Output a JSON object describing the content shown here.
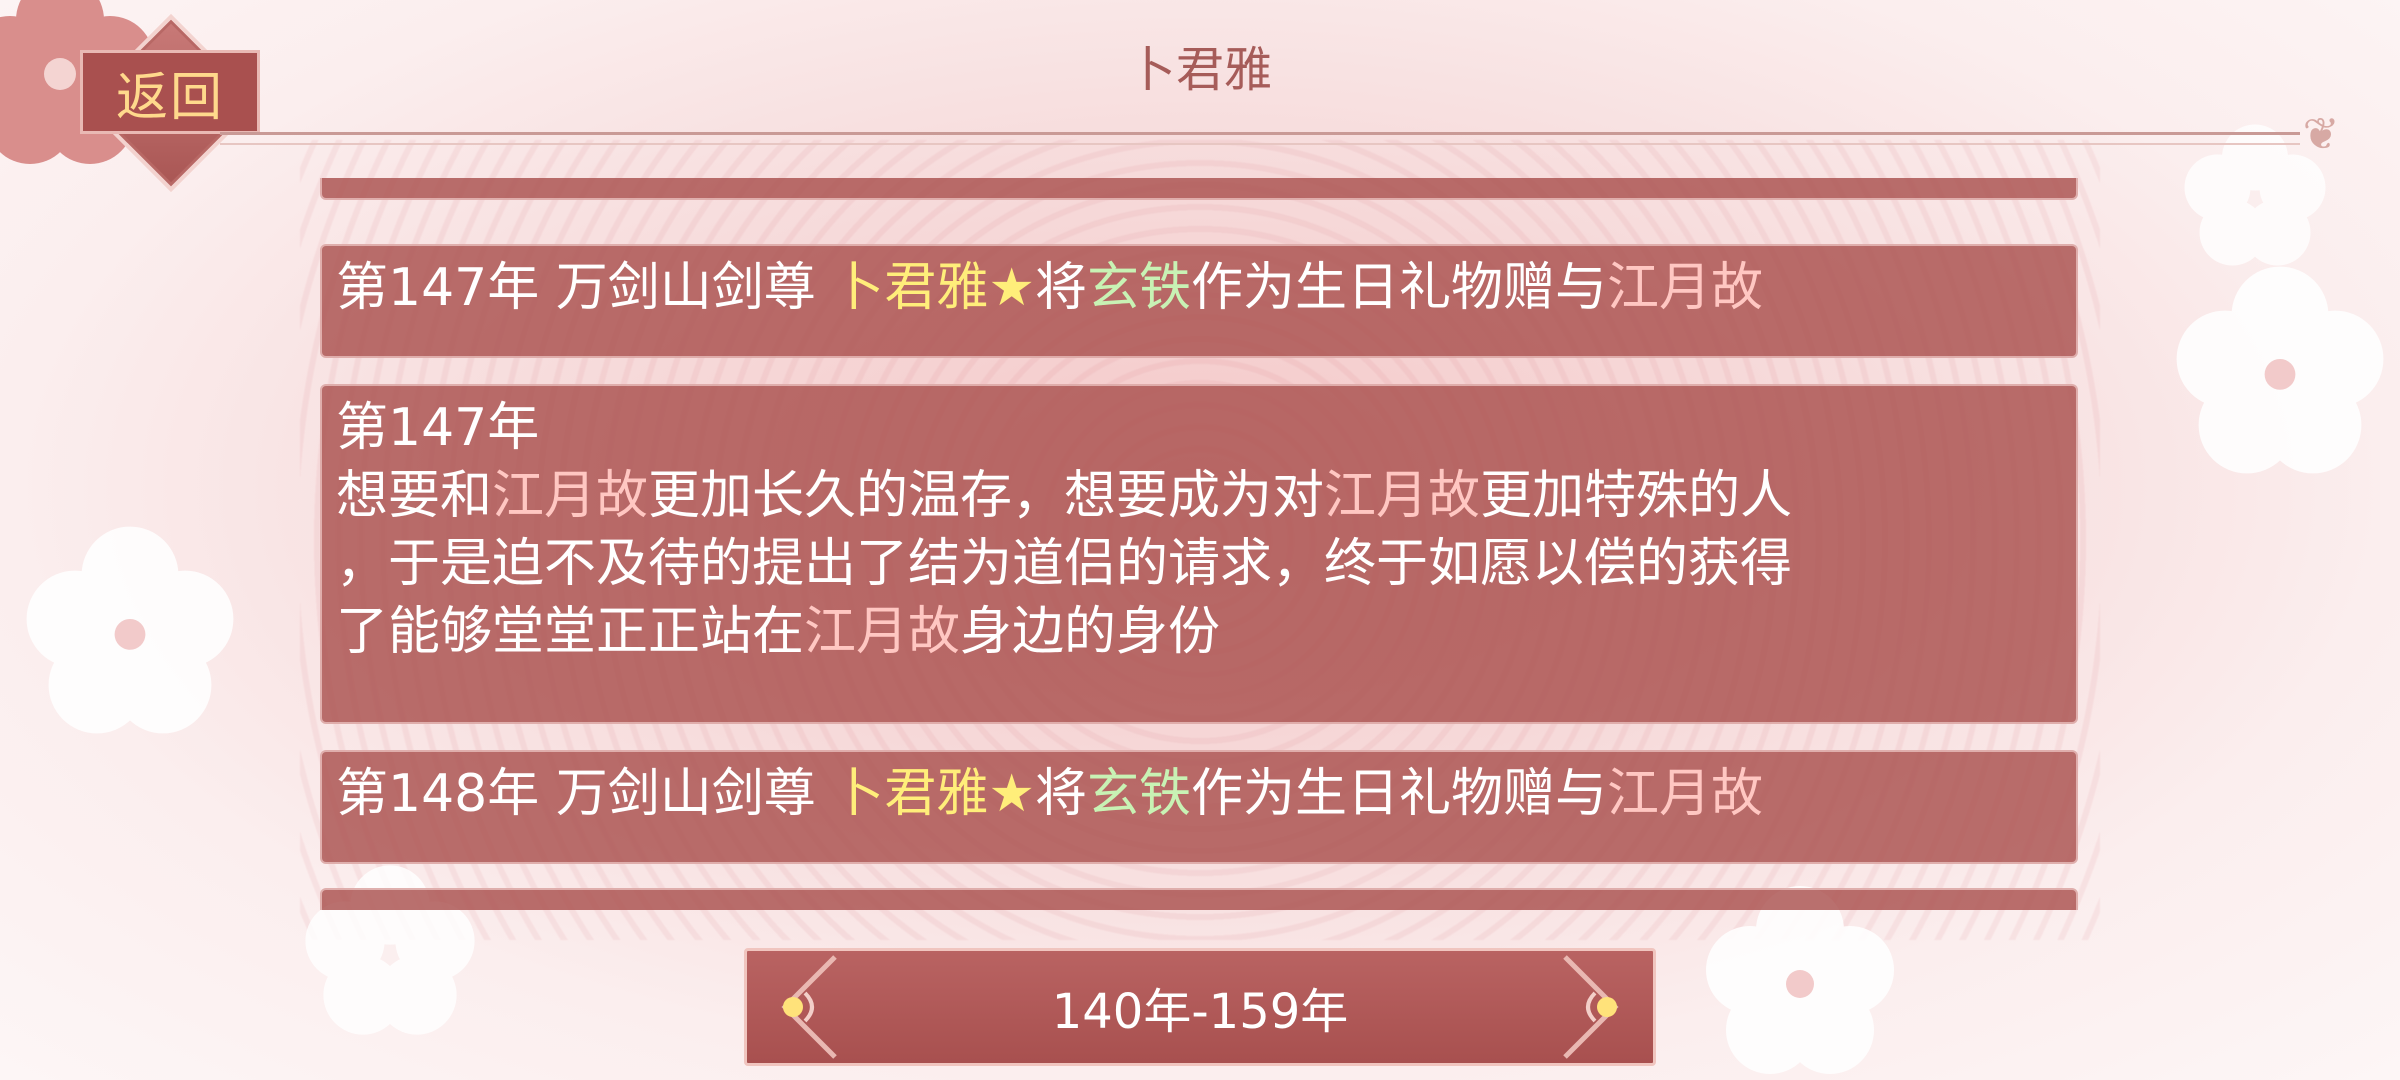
{
  "header": {
    "back_label": "返回",
    "title": "卜君雅"
  },
  "entries": [
    {
      "parts": [
        {
          "text": "第147年 万剑山剑尊 ",
          "style": "plain"
        },
        {
          "text": "卜君雅★",
          "style": "name"
        },
        {
          "text": "将",
          "style": "plain"
        },
        {
          "text": "玄铁",
          "style": "item"
        },
        {
          "text": "作为生日礼物赠与",
          "style": "plain"
        },
        {
          "text": "江月故",
          "style": "person"
        }
      ]
    },
    {
      "lines": [
        [
          {
            "text": "第147年",
            "style": "plain"
          }
        ],
        [
          {
            "text": "想要和",
            "style": "plain"
          },
          {
            "text": "江月故",
            "style": "person"
          },
          {
            "text": "更加长久的温存，想要成为对",
            "style": "plain"
          },
          {
            "text": "江月故",
            "style": "person"
          },
          {
            "text": "更加特殊的人",
            "style": "plain"
          }
        ],
        [
          {
            "text": "，于是迫不及待的提出了结为道侣的请求，终于如愿以偿的获得",
            "style": "plain"
          }
        ],
        [
          {
            "text": "了能够堂堂正正站在",
            "style": "plain"
          },
          {
            "text": "江月故",
            "style": "person"
          },
          {
            "text": "身边的身份",
            "style": "plain"
          }
        ]
      ]
    },
    {
      "parts": [
        {
          "text": "第148年 万剑山剑尊 ",
          "style": "plain"
        },
        {
          "text": "卜君雅★",
          "style": "name"
        },
        {
          "text": "将",
          "style": "plain"
        },
        {
          "text": "玄铁",
          "style": "item"
        },
        {
          "text": "作为生日礼物赠与",
          "style": "plain"
        },
        {
          "text": "江月故",
          "style": "person"
        }
      ]
    }
  ],
  "range": {
    "label": "140年-159年"
  },
  "icons": {
    "prev": "chevron-left-ornament-icon",
    "next": "chevron-right-ornament-icon",
    "swirl": "swirl-ornament-icon"
  },
  "colors": {
    "entry_bg": "#aa504e",
    "name_highlight": "#ffee7a",
    "item_highlight": "#c8f2b4",
    "person_highlight": "#ffc7c2",
    "back_text": "#ffd98c",
    "title_text": "#a65c59"
  }
}
